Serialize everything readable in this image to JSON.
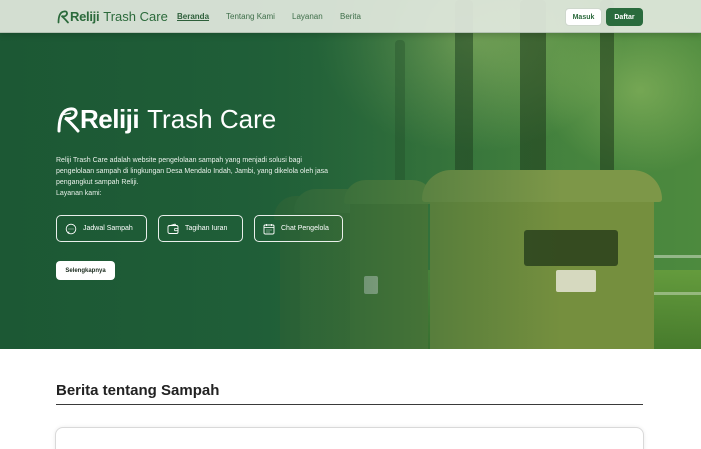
{
  "brand": {
    "name_bold": "Reliji",
    "name_rest": "Trash Care",
    "logo_icon": "leaf-r-logo",
    "color": "#2a6b3d"
  },
  "nav": {
    "links": [
      {
        "label": "Beranda",
        "active": true
      },
      {
        "label": "Tentang Kami",
        "active": false
      },
      {
        "label": "Layanan",
        "active": false
      },
      {
        "label": "Berita",
        "active": false
      }
    ],
    "login_label": "Masuk",
    "register_label": "Daftar"
  },
  "hero": {
    "title_bold": "Reliji",
    "title_rest": "Trash Care",
    "description": "Reliji Trash Care adalah website pengelolaan sampah yang menjadi solusi bagi pengelolaan sampah di lingkungan Desa Mendalo Indah, Jambi, yang dikelola oleh jasa pengangkut sampah Reliji.",
    "services_intro": "Layanan kami:",
    "features": [
      {
        "label": "Jadwal Sampah",
        "icon": "chat-bubble-icon"
      },
      {
        "label": "Tagihan Iuran",
        "icon": "wallet-icon"
      },
      {
        "label": "Chat Pengelola",
        "icon": "calendar-icon"
      }
    ],
    "more_label": "Selengkapnya"
  },
  "news": {
    "title": "Berita tentang Sampah"
  },
  "colors": {
    "primary": "#2a6b3d",
    "hero_overlay": "#1c5834",
    "navbar_bg": "#e1e8de"
  }
}
